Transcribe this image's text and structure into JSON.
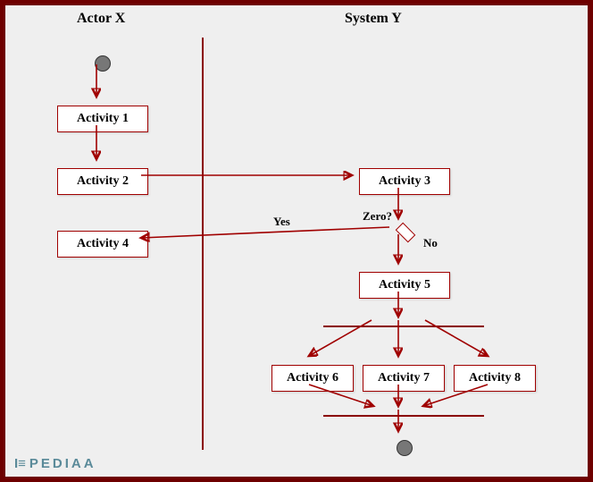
{
  "lanes": {
    "left": "Actor X",
    "right": "System Y"
  },
  "activities": {
    "a1": "Activity 1",
    "a2": "Activity 2",
    "a3": "Activity 3",
    "a4": "Activity 4",
    "a5": "Activity 5",
    "a6": "Activity 6",
    "a7": "Activity 7",
    "a8": "Activity 8"
  },
  "decision": {
    "question": "Zero?",
    "yes": "Yes",
    "no": "No"
  },
  "watermark": "PEDIAA"
}
